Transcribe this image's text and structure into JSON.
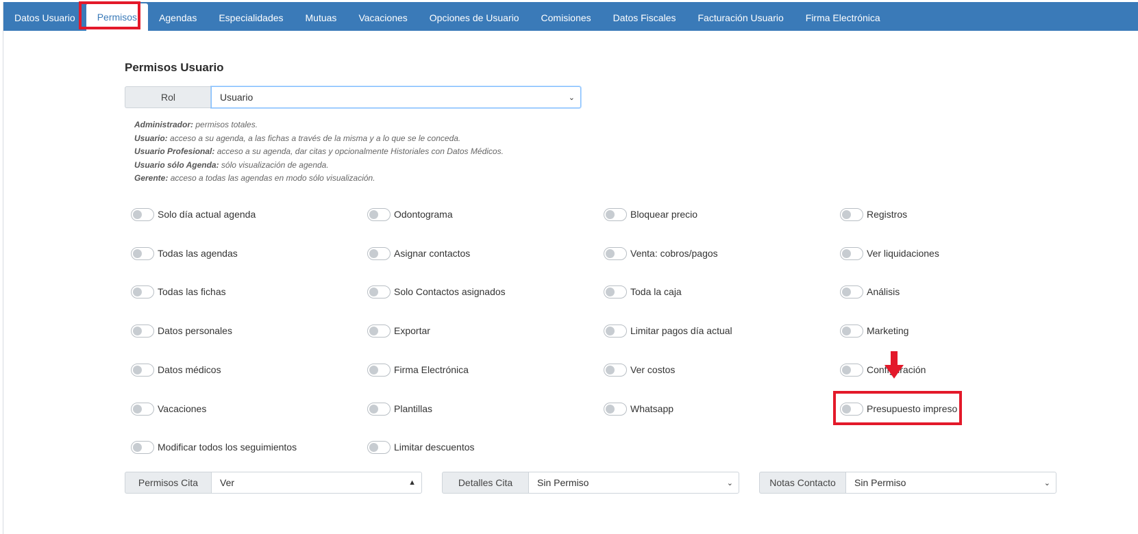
{
  "tabs": [
    {
      "label": "Datos Usuario",
      "active": false
    },
    {
      "label": "Permisos",
      "active": true
    },
    {
      "label": "Agendas",
      "active": false
    },
    {
      "label": "Especialidades",
      "active": false
    },
    {
      "label": "Mutuas",
      "active": false
    },
    {
      "label": "Vacaciones",
      "active": false
    },
    {
      "label": "Opciones de Usuario",
      "active": false
    },
    {
      "label": "Comisiones",
      "active": false
    },
    {
      "label": "Datos Fiscales",
      "active": false
    },
    {
      "label": "Facturación Usuario",
      "active": false
    },
    {
      "label": "Firma Electrónica",
      "active": false
    }
  ],
  "section_title": "Permisos Usuario",
  "rol": {
    "label": "Rol",
    "value": "Usuario"
  },
  "role_notes": [
    {
      "name": "Administrador:",
      "text": " permisos totales."
    },
    {
      "name": "Usuario:",
      "text": " acceso a su agenda, a las fichas a través de la misma y a lo que se le conceda."
    },
    {
      "name": "Usuario Profesional:",
      "text": " acceso a su agenda, dar citas y opcionalmente Historiales con Datos Médicos."
    },
    {
      "name": "Usuario sólo Agenda:",
      "text": " sólo visualización de agenda."
    },
    {
      "name": "Gerente:",
      "text": " acceso a todas las agendas en modo sólo visualización."
    }
  ],
  "permissions": [
    [
      "Solo día actual agenda",
      "Todas las agendas",
      "Todas las fichas",
      "Datos personales",
      "Datos médicos",
      "Vacaciones",
      "Modificar todos los seguimientos"
    ],
    [
      "Odontograma",
      "Asignar contactos",
      "Solo Contactos asignados",
      "Exportar",
      "Firma Electrónica",
      "Plantillas",
      "Limitar descuentos"
    ],
    [
      "Bloquear precio",
      "Venta: cobros/pagos",
      "Toda la caja",
      "Limitar pagos día actual",
      "Ver costos",
      "Whatsapp"
    ],
    [
      "Registros",
      "Ver liquidaciones",
      "Análisis",
      "Marketing",
      "Configuración",
      "Presupuesto impreso"
    ]
  ],
  "bottom_selects": [
    {
      "label": "Permisos Cita",
      "value": "Ver",
      "open": true
    },
    {
      "label": "Detalles Cita",
      "value": "Sin Permiso",
      "open": false
    },
    {
      "label": "Notas Contacto",
      "value": "Sin Permiso",
      "open": false
    }
  ],
  "colors": {
    "header": "#3a7ab8",
    "highlight": "#e3192a"
  }
}
